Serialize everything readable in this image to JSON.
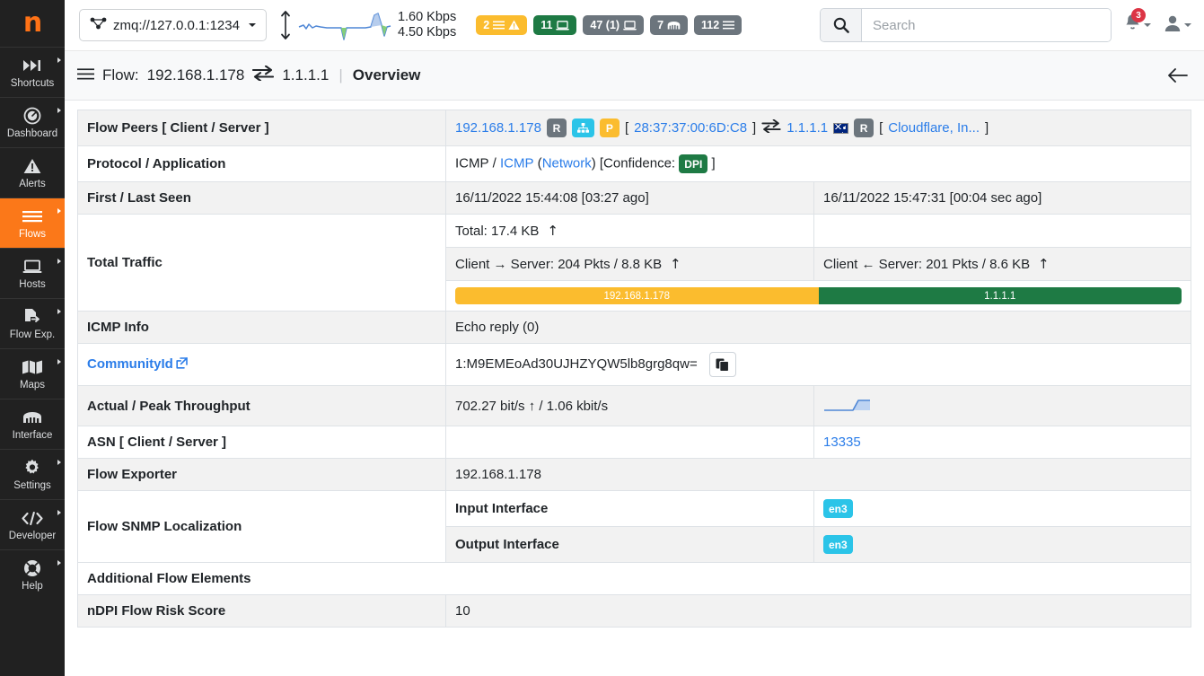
{
  "sidebar": {
    "logo": "n",
    "items": [
      {
        "label": "Shortcuts",
        "icon": "fast-forward-icon",
        "caret": true,
        "active": false
      },
      {
        "label": "Dashboard",
        "icon": "gauge-icon",
        "caret": true,
        "active": false
      },
      {
        "label": "Alerts",
        "icon": "warning-icon",
        "caret": false,
        "active": false
      },
      {
        "label": "Flows",
        "icon": "list-icon",
        "caret": true,
        "active": true
      },
      {
        "label": "Hosts",
        "icon": "laptop-icon",
        "caret": true,
        "active": false
      },
      {
        "label": "Flow Exp.",
        "icon": "file-export-icon",
        "caret": true,
        "active": false
      },
      {
        "label": "Maps",
        "icon": "map-icon",
        "caret": true,
        "active": false
      },
      {
        "label": "Interface",
        "icon": "ethernet-icon",
        "caret": false,
        "active": false
      },
      {
        "label": "Settings",
        "icon": "gear-icon",
        "caret": true,
        "active": false
      },
      {
        "label": "Developer",
        "icon": "code-icon",
        "caret": true,
        "active": false
      },
      {
        "label": "Help",
        "icon": "lifering-icon",
        "caret": true,
        "active": false
      }
    ]
  },
  "topbar": {
    "interface_selector": "zmq://127.0.0.1:1234",
    "rate_download": "1.60 Kbps",
    "rate_upload": "4.50 Kbps",
    "badges": [
      {
        "text": "2",
        "icon": "alert-triangle-icon",
        "color": "#fbbc2e"
      },
      {
        "text": "11",
        "icon": "laptop-icon",
        "color": "#1e7a44"
      },
      {
        "text": "47 (1)",
        "icon": "laptop-icon",
        "color": "#6c757d"
      },
      {
        "text": "7",
        "icon": "ethernet-icon",
        "color": "#6c757d"
      },
      {
        "text": "112",
        "icon": "list-icon",
        "color": "#6c757d"
      }
    ],
    "search_placeholder": "Search",
    "search_value": "",
    "notification_count": "3"
  },
  "page_header": {
    "prefix": "Flow:",
    "client": "192.168.1.178",
    "server": "1.1.1.1",
    "separator": "|",
    "tab": "Overview"
  },
  "flow": {
    "rows": {
      "peers_label": "Flow Peers [ Client / Server ]",
      "client_ip": "192.168.1.178",
      "client_badges": [
        {
          "text": "R",
          "kind": "gray"
        },
        {
          "text": "",
          "kind": "cyan",
          "icon": "sitemap-icon"
        },
        {
          "text": "P",
          "kind": "amber"
        }
      ],
      "client_mac": "28:37:37:00:6D:C8",
      "server_ip": "1.1.1.1",
      "server_badges": [
        {
          "text": "R",
          "kind": "gray"
        }
      ],
      "server_org": "Cloudflare, In...",
      "protocol_label": "Protocol / Application",
      "protocol_master": "ICMP",
      "protocol_app": "ICMP",
      "protocol_category": "Network",
      "confidence_prefix": "[Confidence:",
      "confidence_badge": "DPI",
      "seen_label": "First / Last Seen",
      "first_seen": "16/11/2022 15:44:08 [03:27 ago]",
      "last_seen": "16/11/2022 15:47:31 [00:04 sec ago]",
      "traffic_label": "Total Traffic",
      "total_traffic": "Total: 17.4 KB",
      "client_to_server": "Client → Server: 204 Pkts / 8.8 KB",
      "server_to_client": "Client ← Server: 201 Pkts / 8.6 KB",
      "bar_left_label": "192.168.1.178",
      "bar_right_label": "1.1.1.1",
      "bar_left_pct": 50,
      "bar_left_color": "#fbbc2e",
      "bar_right_color": "#1e7a44",
      "icmp_label": "ICMP Info",
      "icmp_value": "Echo reply (0)",
      "community_label": "CommunityId",
      "community_value": "1:M9EMEoAd30UJHZYQW5lb8grg8qw=",
      "throughput_label": "Actual / Peak Throughput",
      "throughput_value": "702.27 bit/s ↑ / 1.06 kbit/s",
      "asn_label": "ASN [ Client / Server ]",
      "asn_client": "",
      "asn_server": "13335",
      "exporter_label": "Flow Exporter",
      "exporter_value": "192.168.1.178",
      "snmp_label": "Flow SNMP Localization",
      "input_interface_label": "Input Interface",
      "input_interface_value": "en3",
      "output_interface_label": "Output Interface",
      "output_interface_value": "en3",
      "additional_label": "Additional Flow Elements",
      "risk_label": "nDPI Flow Risk Score",
      "risk_value": "10"
    }
  }
}
